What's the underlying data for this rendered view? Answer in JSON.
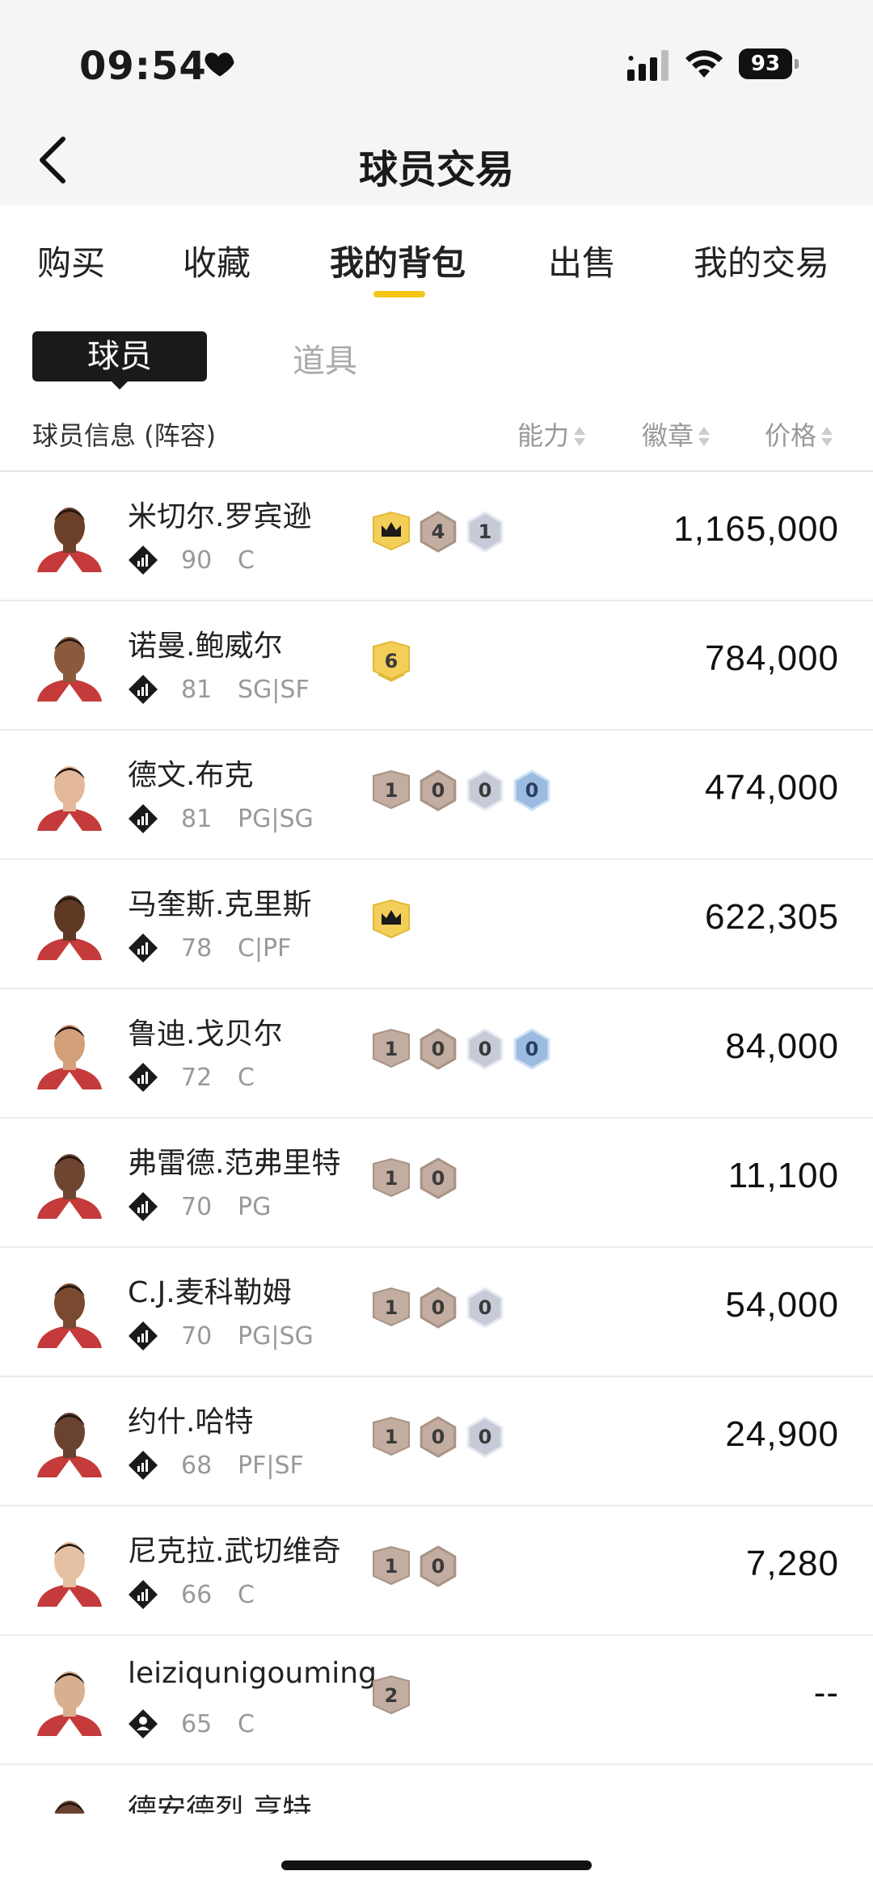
{
  "status_bar": {
    "time": "09:54",
    "battery": "93"
  },
  "nav": {
    "title": "球员交易"
  },
  "tabs": [
    {
      "label": "购买"
    },
    {
      "label": "收藏"
    },
    {
      "label": "我的背包"
    },
    {
      "label": "出售"
    },
    {
      "label": "我的交易"
    }
  ],
  "active_tab_index": 2,
  "segments": {
    "player": "球员",
    "item": "道具"
  },
  "columns": {
    "info": "球员信息 (阵容)",
    "ability": "能力",
    "badge": "徽章",
    "price": "价格"
  },
  "colors": {
    "accent": "#f5c518",
    "badge_gold": "#f3cf5a",
    "badge_bronze": "#c2ada0",
    "badge_silver": "#c7cbd8",
    "badge_blue": "#9cbbe0"
  },
  "players": [
    {
      "name": "米切尔.罗宾逊",
      "rating": "90",
      "position": "C",
      "role_icon": "chart-icon",
      "badges": [
        {
          "type": "crown-gold",
          "label": ""
        },
        {
          "type": "bronze",
          "label": "4"
        },
        {
          "type": "silver",
          "label": "1"
        }
      ],
      "price": "1,165,000",
      "skin": "#6b4028"
    },
    {
      "name": "诺曼.鲍威尔",
      "rating": "81",
      "position": "SG|SF",
      "role_icon": "chart-icon",
      "badges": [
        {
          "type": "gold-number",
          "label": "6"
        }
      ],
      "price": "784,000",
      "skin": "#8a5a3c"
    },
    {
      "name": "德文.布克",
      "rating": "81",
      "position": "PG|SG",
      "role_icon": "chart-icon",
      "badges": [
        {
          "type": "bronze-hex",
          "label": "1"
        },
        {
          "type": "bronze",
          "label": "0"
        },
        {
          "type": "silver",
          "label": "0"
        },
        {
          "type": "blue",
          "label": "0"
        }
      ],
      "price": "474,000",
      "skin": "#e3b99a"
    },
    {
      "name": "马奎斯.克里斯",
      "rating": "78",
      "position": "C|PF",
      "role_icon": "chart-icon",
      "badges": [
        {
          "type": "crown-gold",
          "label": ""
        }
      ],
      "price": "622,305",
      "skin": "#5e3a24"
    },
    {
      "name": "鲁迪.戈贝尔",
      "rating": "72",
      "position": "C",
      "role_icon": "chart-icon",
      "badges": [
        {
          "type": "bronze-hex",
          "label": "1"
        },
        {
          "type": "bronze",
          "label": "0"
        },
        {
          "type": "silver",
          "label": "0"
        },
        {
          "type": "blue",
          "label": "0"
        }
      ],
      "price": "84,000",
      "skin": "#d4a07a"
    },
    {
      "name": "弗雷德.范弗里特",
      "rating": "70",
      "position": "PG",
      "role_icon": "chart-icon",
      "badges": [
        {
          "type": "bronze-hex",
          "label": "1"
        },
        {
          "type": "bronze",
          "label": "0"
        }
      ],
      "price": "11,100",
      "skin": "#6e4530"
    },
    {
      "name": "C.J.麦科勒姆",
      "rating": "70",
      "position": "PG|SG",
      "role_icon": "chart-icon",
      "badges": [
        {
          "type": "bronze-hex",
          "label": "1"
        },
        {
          "type": "bronze",
          "label": "0"
        },
        {
          "type": "silver",
          "label": "0"
        }
      ],
      "price": "54,000",
      "skin": "#7a4a30"
    },
    {
      "name": "约什.哈特",
      "rating": "68",
      "position": "PF|SF",
      "role_icon": "chart-icon",
      "badges": [
        {
          "type": "bronze-hex",
          "label": "1"
        },
        {
          "type": "bronze",
          "label": "0"
        },
        {
          "type": "silver",
          "label": "0"
        }
      ],
      "price": "24,900",
      "skin": "#6a4230"
    },
    {
      "name": "尼克拉.武切维奇",
      "rating": "66",
      "position": "C",
      "role_icon": "chart-icon",
      "badges": [
        {
          "type": "bronze-hex",
          "label": "1"
        },
        {
          "type": "bronze",
          "label": "0"
        }
      ],
      "price": "7,280",
      "skin": "#e6c0a2"
    },
    {
      "name": "leiziqunigouming",
      "rating": "65",
      "position": "C",
      "role_icon": "person-icon",
      "badges": [
        {
          "type": "bronze-number",
          "label": "2"
        }
      ],
      "price": "--",
      "skin": "#d8b090"
    },
    {
      "name": "德安德烈.亨特",
      "rating": "",
      "position": "",
      "role_icon": "chart-icon",
      "badges": [],
      "price": "",
      "skin": "#6a4230"
    }
  ]
}
